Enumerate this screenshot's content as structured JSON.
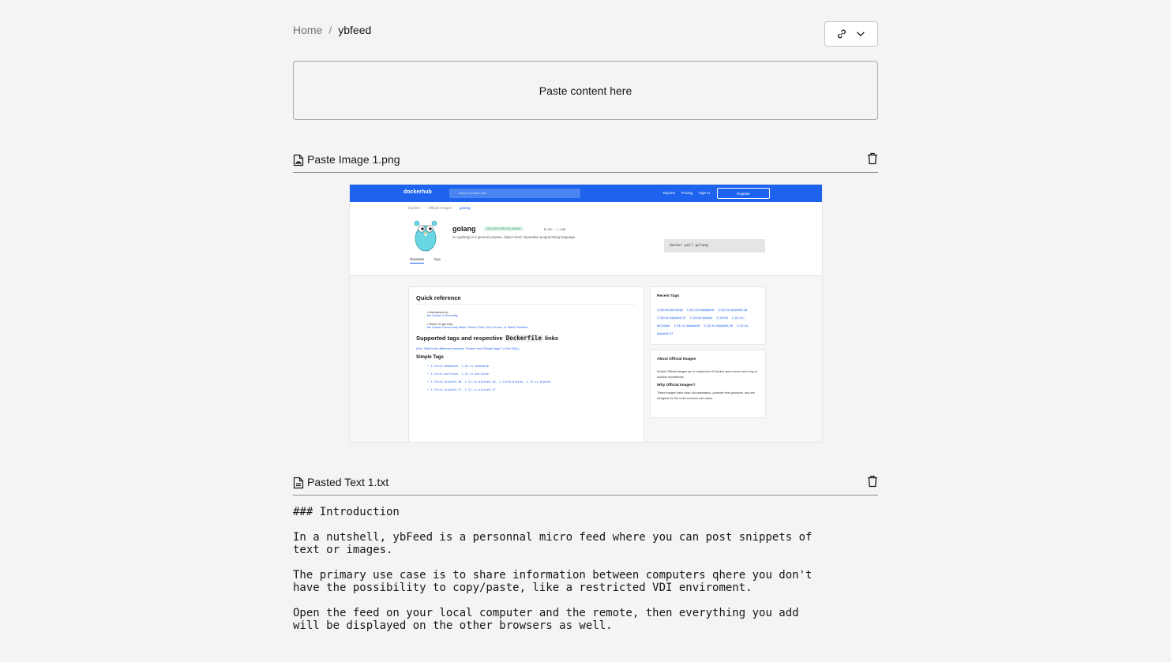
{
  "breadcrumb": {
    "home": "Home",
    "separator": "/",
    "current": "ybfeed"
  },
  "share_menu": {
    "icons": [
      "link-icon",
      "chevron-down-icon"
    ]
  },
  "paste_area": {
    "label": "Paste content here"
  },
  "items": [
    {
      "type": "image",
      "filename": "Paste Image 1.png",
      "screenshot": {
        "nav": {
          "logo": "dockerhub",
          "search_placeholder": "Search Docker Hub",
          "links": [
            "Explore",
            "Pricing",
            "Sign In"
          ],
          "register": "Register"
        },
        "crumbs": [
          "Explore",
          "Official Images",
          "golang"
        ],
        "title": "golang",
        "badge": "DOCKER OFFICIAL IMAGE",
        "stats": "· ⬇ 1B+ · ☆ 4.6K",
        "description": "Go (golang) is a general purpose, higher-level, imperative programming language.",
        "pull_command": "docker pull golang",
        "tabs": [
          "Overview",
          "Tags"
        ],
        "quick_reference": "Quick reference",
        "maintained_by": "• Maintained by:",
        "maintained_link": "the Docker Community",
        "where_help": "• Where to get help:",
        "help_link": "the Docker Community Slack, Server Fault, Unix & Linux, or Stack Overflow",
        "supported_tags": "Supported tags and respective",
        "dockerfile": "Dockerfile",
        "links_word": "links",
        "faq_note": "(See \"What's the difference between 'Shared' and 'Simple' tags?\" in the FAQ.)",
        "simple_tags": "Simple Tags",
        "tag_lines": [
          "• 1.21rc4-bookworm, 1.21-rc-bookworm",
          "• 1.21rc4-bullseye, 1.21-rc-bullseye",
          "• 1.21rc4-alpine3.18, 1.21-rc-alpine3.18, 1.21rc4-alpine, 1.21-rc-alpine",
          "• 1.21rc4-alpine3.17, 1.21-rc-alpine3.17"
        ],
        "recent_tags": "Recent Tags",
        "recent_tag_list": [
          "1.21rc4-bullseye",
          "1.21-rc4-bookworm",
          "1.21rc4-alpine3.18",
          "1.21rc4-alpine3.17",
          "1.21rc4-alpine",
          "1.21rc4",
          "1.21-rc-bullseye",
          "1.21-rc-bookworm",
          "1.21-rc-alpine3.18",
          "1.21-rc-alpine3.17"
        ],
        "about_title": "About Official Images",
        "about_text": "Docker Official Images are a curated set of Docker open source and drop-in solution repositories.",
        "why_title": "Why Official Images?",
        "why_text": "These images have clear documentation, promote best practices, and are designed for the most common use cases."
      }
    },
    {
      "type": "text",
      "filename": "Pasted Text 1.txt",
      "lines": [
        "### Introduction",
        "In a nutshell, ybFeed is a personnal micro feed where you can post snippets of text or images.",
        "The primary use case is to share information between computers qhere you don't have the possibility to copy/paste, like a restricted VDI enviroment.",
        "Open the feed on your local computer and the remote, then everything you add will be displayed on the other browsers as well."
      ]
    }
  ]
}
